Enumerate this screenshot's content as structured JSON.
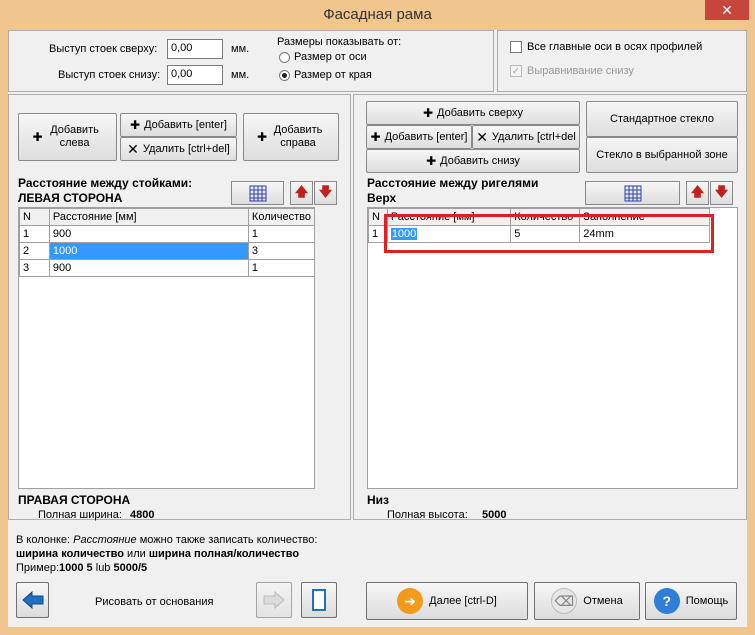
{
  "window": {
    "title": "Фасадная рама",
    "close": "✕"
  },
  "top": {
    "post_top_label": "Выступ стоек сверху:",
    "post_top_value": "0,00",
    "post_bottom_label": "Выступ стоек снизу:",
    "post_bottom_value": "0,00",
    "unit": "мм.",
    "dims_label": "Размеры показывать от:",
    "radio_axis": "Размер от оси",
    "radio_edge": "Размер от края",
    "chk_axes": "Все главные оси в осях профилей",
    "chk_align": "Выравнивание снизу"
  },
  "left": {
    "add_left": "Добавить слева",
    "add_enter": "Добавить [enter]",
    "delete": "Удалить [ctrl+del]",
    "add_right": "Добавить справа",
    "heading1": "Расстояние между стойками:",
    "heading2": "ЛЕВАЯ СТОРОНА",
    "col_n": "N",
    "col_dist": "Расстояние [мм]",
    "col_qty": "Количество",
    "rows": [
      {
        "n": "1",
        "dist": "900",
        "qty": "1"
      },
      {
        "n": "2",
        "dist": "1000",
        "qty": "3"
      },
      {
        "n": "3",
        "dist": "900",
        "qty": "1"
      }
    ],
    "footer_side": "ПРАВАЯ СТОРОНА",
    "footer_label": "Полная ширина:",
    "footer_value": "4800"
  },
  "right": {
    "add_top": "Добавить сверху",
    "add_enter": "Добавить [enter]",
    "delete": "Удалить [ctrl+del",
    "add_bottom": "Добавить снизу",
    "std_glass": "Стандартное стекло",
    "glass_zone": "Стекло в выбранной зоне",
    "heading1": "Расстояние между ригелями",
    "heading2": "Верх",
    "col_n": "N",
    "col_dist": "Расстояние [мм]",
    "col_qty": "Количество",
    "col_fill": "Заполнение",
    "rows": [
      {
        "n": "1",
        "dist": "1000",
        "qty": "5",
        "fill": "24mm"
      }
    ],
    "footer_side": "Низ",
    "footer_label": "Полная высота:",
    "footer_value": "5000"
  },
  "hint": {
    "line1_a": "В колонке: ",
    "line1_b": "Расстояние",
    "line1_c": " можно также записать количество:",
    "line2_a": "ширина количество",
    "line2_b": " или ",
    "line2_c": "ширина полная/количество",
    "line3_a": "Пример:",
    "line3_b": "1000 5",
    "line3_c": " lub ",
    "line3_d": "5000/5"
  },
  "bottom": {
    "draw_label": "Рисовать от основания",
    "next": "Далее [ctrl-D]",
    "cancel": "Отмена",
    "help": "Помощь"
  }
}
